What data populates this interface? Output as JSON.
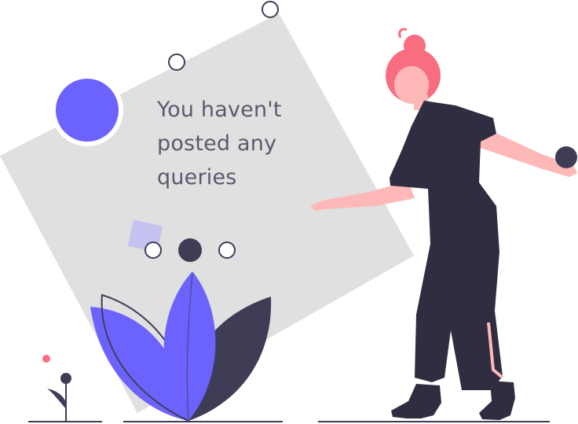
{
  "empty_state": {
    "message_lines": [
      "You haven't",
      "posted any",
      "queries"
    ]
  },
  "colors": {
    "accent": "#6c63ff",
    "dark": "#3f3d56",
    "panel": "#e0e0e0",
    "skin": "#ffb8b8",
    "hair": "#f86d80",
    "text": "#5a5a6e"
  }
}
